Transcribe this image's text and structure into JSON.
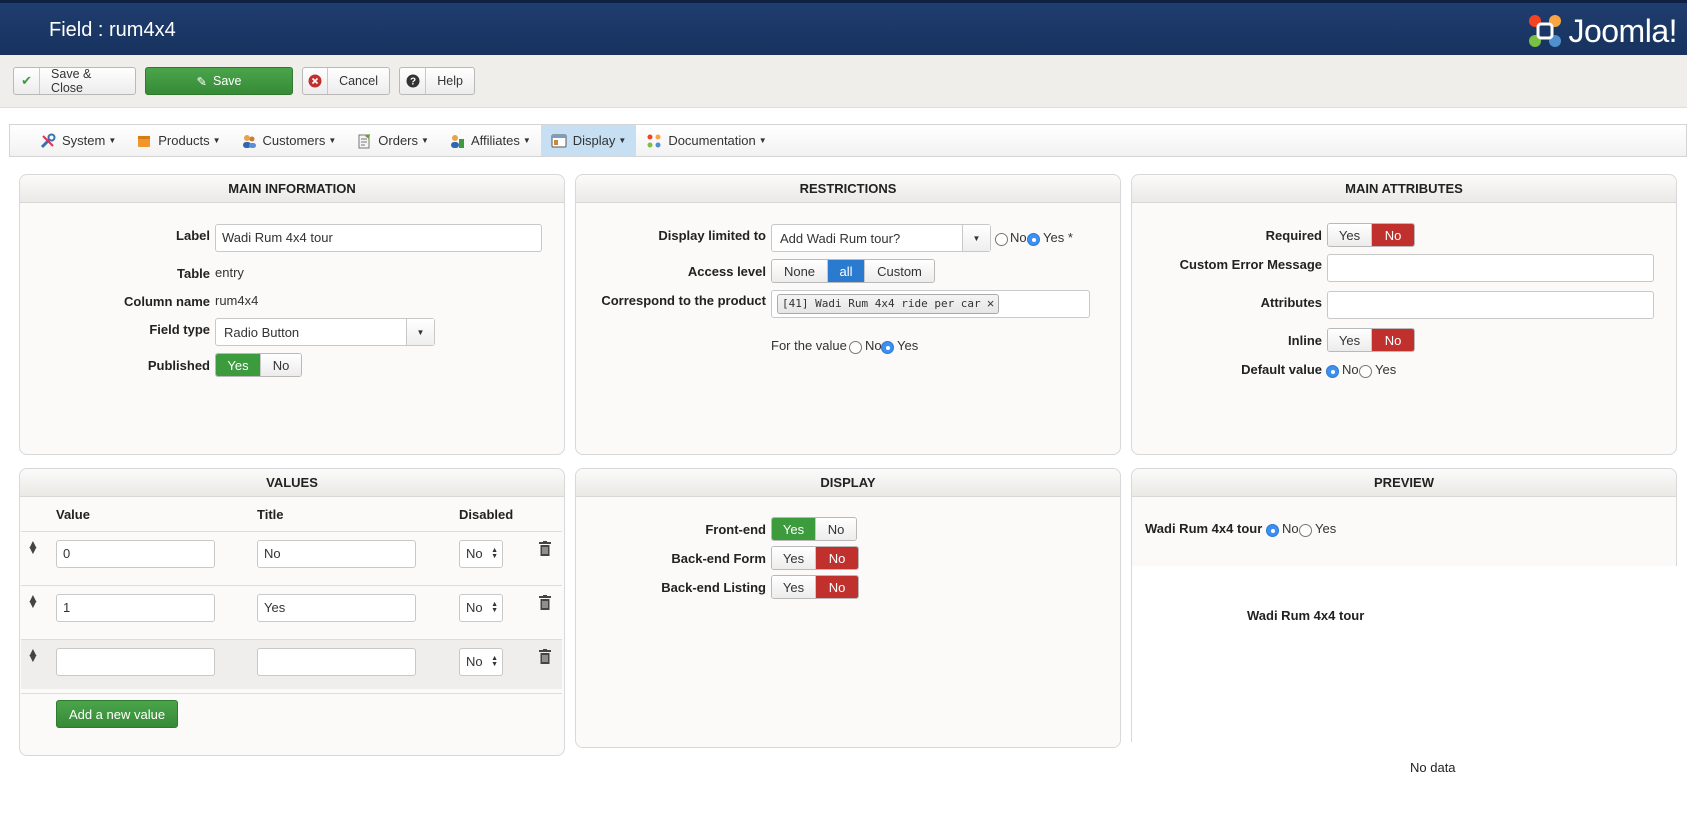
{
  "header": {
    "title": "Field : rum4x4",
    "logo_text": "Joomla!"
  },
  "toolbar": {
    "save_close": "Save & Close",
    "save": "Save",
    "cancel": "Cancel",
    "help": "Help"
  },
  "menu": {
    "items": [
      {
        "label": "System",
        "icon": "tools-icon"
      },
      {
        "label": "Products",
        "icon": "box-icon"
      },
      {
        "label": "Customers",
        "icon": "customers-icon"
      },
      {
        "label": "Orders",
        "icon": "orders-icon"
      },
      {
        "label": "Affiliates",
        "icon": "affiliates-icon"
      },
      {
        "label": "Display",
        "icon": "display-icon"
      },
      {
        "label": "Documentation",
        "icon": "documentation-icon"
      }
    ]
  },
  "main_info": {
    "title": "MAIN INFORMATION",
    "label_label": "Label",
    "label_value": "Wadi Rum 4x4 tour",
    "table_label": "Table",
    "table_value": "entry",
    "column_label": "Column name",
    "column_value": "rum4x4",
    "fieldtype_label": "Field type",
    "fieldtype_value": "Radio Button",
    "published_label": "Published",
    "yes": "Yes",
    "no": "No"
  },
  "restrictions": {
    "title": "RESTRICTIONS",
    "display_limited_label": "Display limited to",
    "display_limited_value": "Add Wadi Rum tour?",
    "no": "No",
    "yes_star": "Yes *",
    "access_label": "Access level",
    "access_none": "None",
    "access_all": "all",
    "access_custom": "Custom",
    "correspond_label": "Correspond to the product",
    "correspond_tag": "[41] Wadi Rum 4x4 ride per car",
    "for_value_label": "For the value",
    "yes": "Yes"
  },
  "main_attributes": {
    "title": "MAIN ATTRIBUTES",
    "required_label": "Required",
    "yes": "Yes",
    "no": "No",
    "custom_error_label": "Custom Error Message",
    "attributes_label": "Attributes",
    "inline_label": "Inline",
    "default_label": "Default value"
  },
  "values": {
    "title": "VALUES",
    "col_value": "Value",
    "col_title": "Title",
    "col_disabled": "Disabled",
    "rows": [
      {
        "value": "0",
        "title": "No",
        "disabled": "No"
      },
      {
        "value": "1",
        "title": "Yes",
        "disabled": "No"
      },
      {
        "value": "",
        "title": "",
        "disabled": "No"
      }
    ],
    "add_button": "Add a new value"
  },
  "display": {
    "title": "DISPLAY",
    "frontend_label": "Front-end",
    "backend_form_label": "Back-end Form",
    "backend_listing_label": "Back-end Listing",
    "yes": "Yes",
    "no": "No"
  },
  "preview": {
    "title": "PREVIEW",
    "field_label": "Wadi Rum 4x4 tour",
    "no": "No",
    "yes": "Yes",
    "heading": "Wadi Rum 4x4 tour",
    "no_data": "No data"
  },
  "colors": {
    "header_bg": "#1a3867",
    "green": "#3c9b3c",
    "red": "#c0312e",
    "blue": "#2a7bd0",
    "menu_active": "#c6dff3"
  }
}
